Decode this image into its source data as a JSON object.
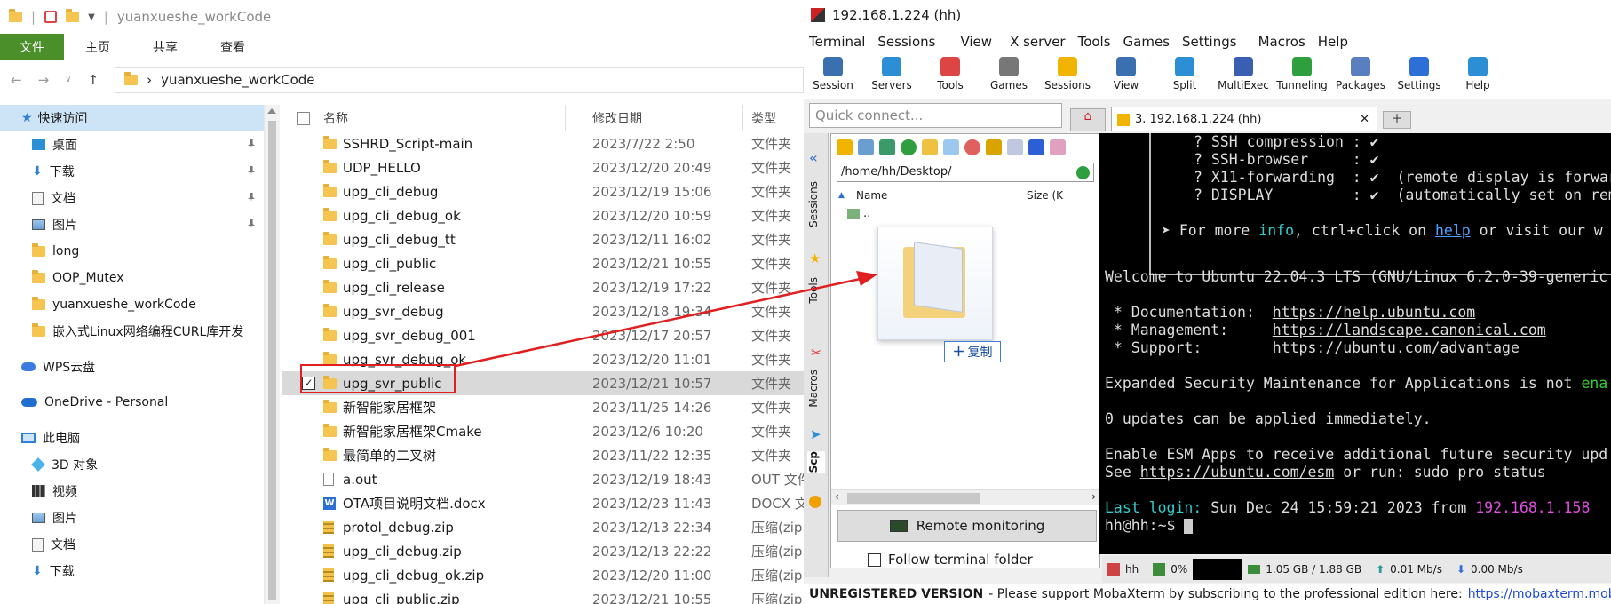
{
  "explorer": {
    "window_title": "yuanxueshe_workCode",
    "ribbon_tabs": [
      "文件",
      "主页",
      "共享",
      "查看"
    ],
    "address": "yuanxueshe_workCode",
    "nav_items": [
      {
        "label": "快速访问",
        "icon": "star-icon",
        "selected": true,
        "pinned": false
      },
      {
        "label": "桌面",
        "icon": "desktop-icon",
        "pinned": true
      },
      {
        "label": "下载",
        "icon": "download-icon",
        "pinned": true
      },
      {
        "label": "文档",
        "icon": "document-icon",
        "pinned": true
      },
      {
        "label": "图片",
        "icon": "picture-icon",
        "pinned": true
      },
      {
        "label": "long",
        "icon": "folder-icon"
      },
      {
        "label": "OOP_Mutex",
        "icon": "folder-icon"
      },
      {
        "label": "yuanxueshe_workCode",
        "icon": "folder-icon"
      },
      {
        "label": "嵌入式Linux网络编程CURL库开发",
        "icon": "folder-icon"
      },
      {
        "label": "WPS云盘",
        "icon": "cloud-icon"
      },
      {
        "label": "OneDrive - Personal",
        "icon": "onedrive-icon"
      },
      {
        "label": "此电脑",
        "icon": "computer-icon"
      },
      {
        "label": "3D 对象",
        "icon": "3d-icon"
      },
      {
        "label": "视频",
        "icon": "video-icon"
      },
      {
        "label": "图片",
        "icon": "picture-icon"
      },
      {
        "label": "文档",
        "icon": "document-icon"
      },
      {
        "label": "下载",
        "icon": "download-icon"
      }
    ],
    "columns": {
      "name": "名称",
      "date": "修改日期",
      "type": "类型"
    },
    "files": [
      {
        "name": "SSHRD_Script-main",
        "date": "2023/7/22 2:50",
        "type": "文件夹",
        "kind": "folder"
      },
      {
        "name": "UDP_HELLO",
        "date": "2023/12/20 20:49",
        "type": "文件夹",
        "kind": "folder"
      },
      {
        "name": "upg_cli_debug",
        "date": "2023/12/19 15:06",
        "type": "文件夹",
        "kind": "folder"
      },
      {
        "name": "upg_cli_debug_ok",
        "date": "2023/12/20 10:59",
        "type": "文件夹",
        "kind": "folder"
      },
      {
        "name": "upg_cli_debug_tt",
        "date": "2023/12/11 16:02",
        "type": "文件夹",
        "kind": "folder"
      },
      {
        "name": "upg_cli_public",
        "date": "2023/12/21 10:55",
        "type": "文件夹",
        "kind": "folder"
      },
      {
        "name": "upg_cli_release",
        "date": "2023/12/19 17:22",
        "type": "文件夹",
        "kind": "folder"
      },
      {
        "name": "upg_svr_debug",
        "date": "2023/12/18 19:34",
        "type": "文件夹",
        "kind": "folder"
      },
      {
        "name": "upg_svr_debug_001",
        "date": "2023/12/17 20:57",
        "type": "文件夹",
        "kind": "folder"
      },
      {
        "name": "upg_svr_debug_ok",
        "date": "2023/12/20 11:01",
        "type": "文件夹",
        "kind": "folder"
      },
      {
        "name": "upg_svr_public",
        "date": "2023/12/21 10:57",
        "type": "文件夹",
        "kind": "folder",
        "selected": true
      },
      {
        "name": "新智能家居框架",
        "date": "2023/11/25 14:26",
        "type": "文件夹",
        "kind": "folder"
      },
      {
        "name": "新智能家居框架Cmake",
        "date": "2023/12/6 10:20",
        "type": "文件夹",
        "kind": "folder"
      },
      {
        "name": "最简单的二叉树",
        "date": "2023/11/22 12:35",
        "type": "文件夹",
        "kind": "folder"
      },
      {
        "name": "a.out",
        "date": "2023/12/19 18:43",
        "type": "OUT 文件",
        "kind": "file"
      },
      {
        "name": "OTA项目说明文档.docx",
        "date": "2023/12/23 11:43",
        "type": "DOCX 文",
        "kind": "docx"
      },
      {
        "name": "protol_debug.zip",
        "date": "2023/12/13 22:34",
        "type": "压缩(zip",
        "kind": "zip"
      },
      {
        "name": "upg_cli_debug.zip",
        "date": "2023/12/13 22:22",
        "type": "压缩(zip",
        "kind": "zip"
      },
      {
        "name": "upg_cli_debug_ok.zip",
        "date": "2023/12/20 11:00",
        "type": "压缩(zip",
        "kind": "zip"
      },
      {
        "name": "upg_cli_public.zip",
        "date": "2023/12/21 10:55",
        "type": "压缩(zip",
        "kind": "zip"
      }
    ]
  },
  "moba": {
    "title": "192.168.1.224 (hh)",
    "menu": [
      "Terminal",
      "Sessions",
      "View",
      "X server",
      "Tools",
      "Games",
      "Settings",
      "Macros",
      "Help"
    ],
    "toolbar": [
      {
        "label": "Session",
        "icon": "session-icon",
        "color": "#3a6fb0"
      },
      {
        "label": "Servers",
        "icon": "servers-icon",
        "color": "#2c8fd6"
      },
      {
        "label": "Tools",
        "icon": "tools-icon",
        "color": "#d44"
      },
      {
        "label": "Games",
        "icon": "games-icon",
        "color": "#777"
      },
      {
        "label": "Sessions",
        "icon": "star-icon",
        "color": "#f0b400"
      },
      {
        "label": "View",
        "icon": "view-icon",
        "color": "#3a6fb0"
      },
      {
        "label": "Split",
        "icon": "split-icon",
        "color": "#2c8fd6"
      },
      {
        "label": "MultiExec",
        "icon": "multiexec-icon",
        "color": "#3a5fb0"
      },
      {
        "label": "Tunneling",
        "icon": "tunneling-icon",
        "color": "#2e9e3e"
      },
      {
        "label": "Packages",
        "icon": "packages-icon",
        "color": "#5a7fc0"
      },
      {
        "label": "Settings",
        "icon": "settings-icon",
        "color": "#2c6fd6"
      },
      {
        "label": "Help",
        "icon": "help-icon",
        "color": "#2c8fd6"
      }
    ],
    "quick_connect_placeholder": "Quick connect...",
    "session_tab": "3. 192.168.1.224 (hh)",
    "side_tabs": [
      "Sessions",
      "Tools",
      "Macros",
      "Scp"
    ],
    "sftp_path": "/home/hh/Desktop/",
    "sftp_cols": {
      "name": "Name",
      "size": "Size (K"
    },
    "sftp_parent": "..",
    "remote_monitoring": "Remote monitoring",
    "follow_folder": "Follow terminal folder",
    "drag_badge": "复制",
    "terminal": {
      "box_lines": [
        "? SSH compression : ✔",
        "? SSH-browser     : ✔",
        "? X11-forwarding  : ✔  (remote display is forwar",
        "? DISPLAY         : ✔  (automatically set on rem"
      ],
      "more_info_prefix": "➤ For more ",
      "more_info_info": "info",
      "more_info_mid": ", ctrl+click on ",
      "more_info_help": "help",
      "more_info_suffix": " or visit our w",
      "welcome": "Welcome to Ubuntu 22.04.3 LTS (GNU/Linux 6.2.0-39-generic",
      "doc_label": " * Documentation:  ",
      "doc_url": "https://help.ubuntu.com",
      "mgmt_label": " * Management:     ",
      "mgmt_url": "https://landscape.canonical.com",
      "support_label": " * Support:        ",
      "support_url": "https://ubuntu.com/advantage",
      "esm": "Expanded Security Maintenance for Applications is not ",
      "esm_tail": "ena",
      "updates": "0 updates can be applied immediately.",
      "enable1": "Enable ESM Apps to receive additional future security upd",
      "enable2_a": "See ",
      "enable2_url": "https://ubuntu.com/esm",
      "enable2_b": " or run: sudo pro status",
      "last_login_label": "Last login:",
      "last_login_date": " Sun Dec 24 15:59:21 2023 from ",
      "last_login_ip": "192.168.1.158",
      "prompt": "hh@hh:~$ "
    },
    "status": {
      "user": "hh",
      "cpu": "0%",
      "mem": "1.05 GB / 1.88 GB",
      "up": "0.01 Mb/s",
      "down": "0.00 Mb/s"
    },
    "unregistered": "UNREGISTERED VERSION",
    "support_text": " -  Please support MobaXterm by subscribing to the professional edition here:",
    "support_url": "https://mobaxterm.mobatek"
  }
}
